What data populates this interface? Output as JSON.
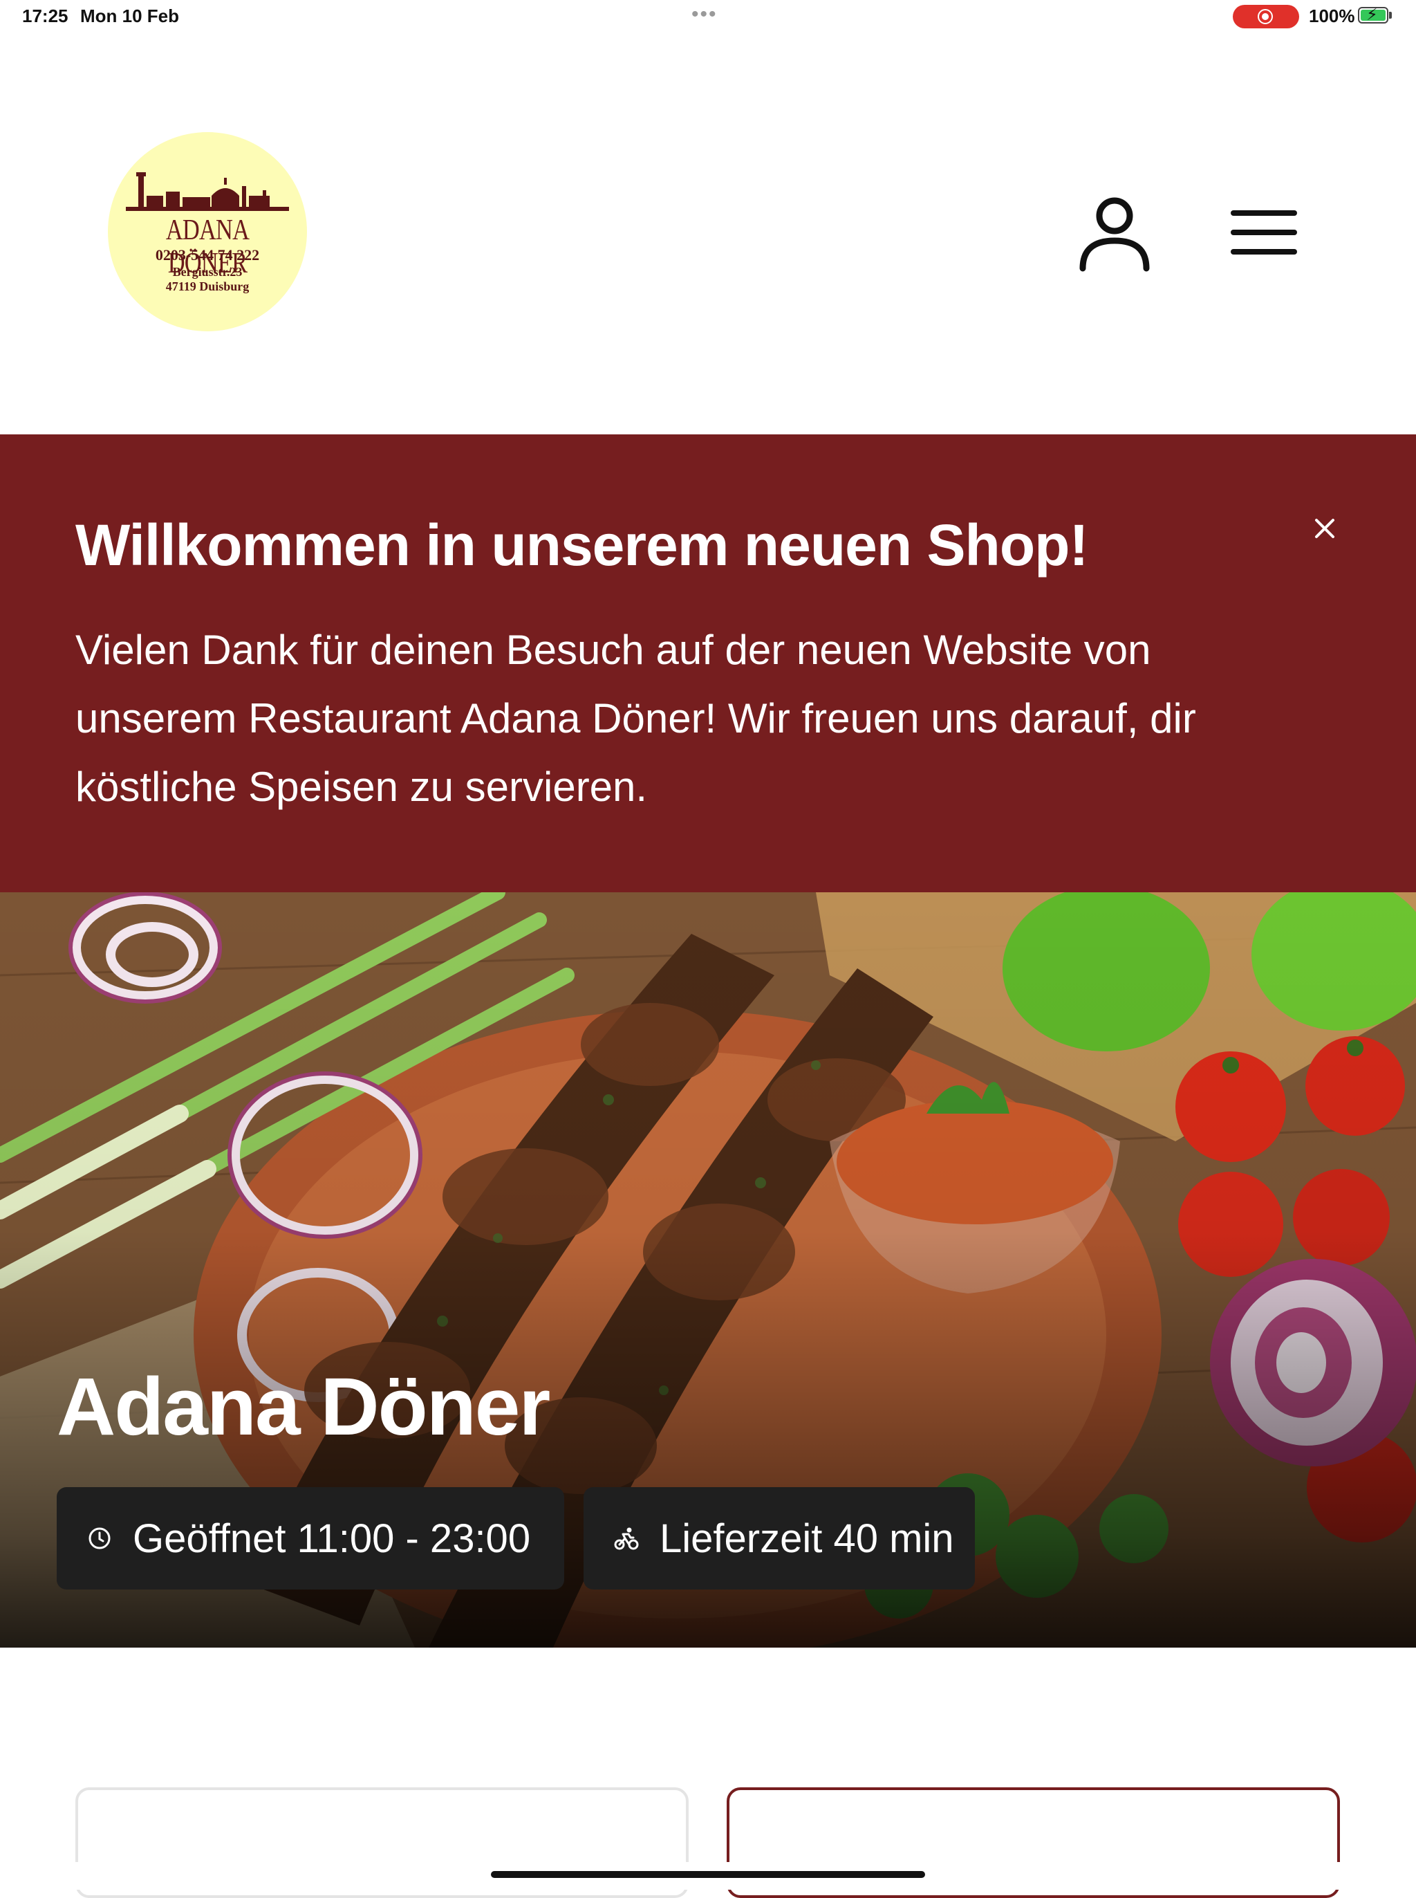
{
  "status_bar": {
    "time": "17:25",
    "date": "Mon 10 Feb",
    "dots": "•••",
    "battery": "100%"
  },
  "header": {
    "logo": {
      "name": "ADANA DÖNER",
      "phone": "0203-544 74 222",
      "street": "Bergiusstr.23",
      "city": "47119 Duisburg"
    },
    "account_icon": "user-icon",
    "menu_icon": "hamburger-menu-icon"
  },
  "banner": {
    "title": "Willkommen in unserem neuen Shop!",
    "text": "Vielen Dank für deinen Besuch auf der neuen Website von unserem Restaurant Adana Döner! Wir freuen uns darauf, dir köstliche Speisen zu servieren.",
    "close_icon": "close-icon"
  },
  "hero": {
    "title": "Adana Döner",
    "opening": "Geöffnet 11:00 - 23:00",
    "delivery": "Lieferzeit 40 min"
  },
  "colors": {
    "brand": "#761e1f",
    "logo_bg": "#fdfcb6",
    "chip_bg": "#1f1f1f"
  }
}
